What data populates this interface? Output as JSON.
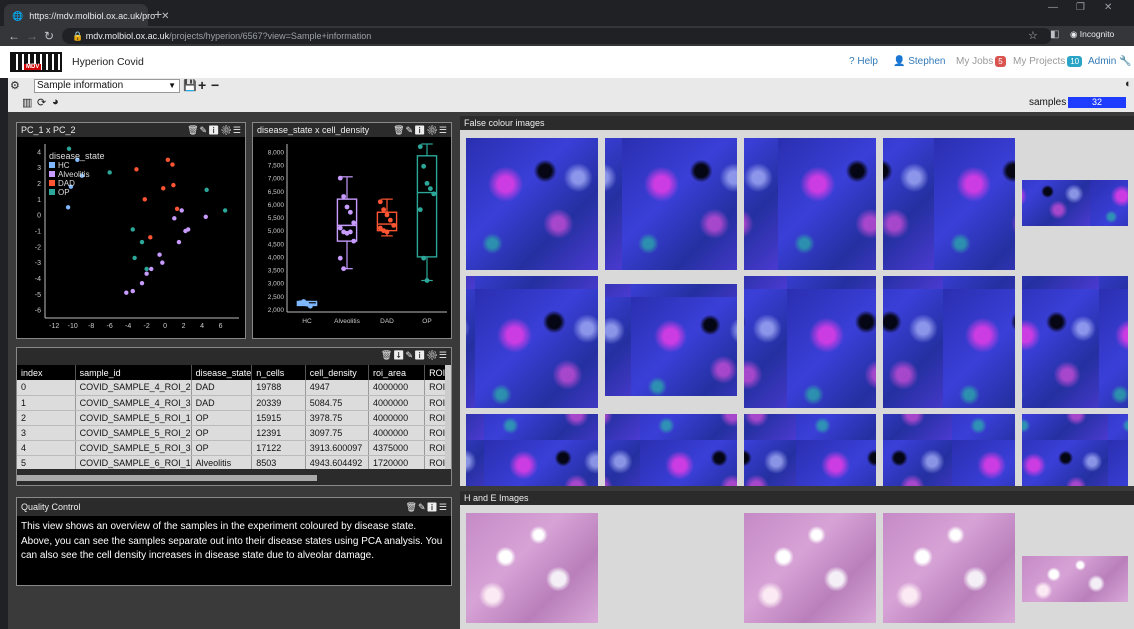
{
  "browser": {
    "tab_title": "https://mdv.molbiol.ox.ac.uk/pro",
    "url_host": "mdv.molbiol.ox.ac.uk",
    "url_path": "/projects/hyperion/6567?view=Sample+information",
    "incognito_label": "Incognito"
  },
  "header": {
    "logo_text": "MDV",
    "title": "Hyperion Covid",
    "help": "Help",
    "user": "Stephen",
    "my_jobs": "My Jobs",
    "my_jobs_count": "5",
    "my_projects": "My Projects",
    "my_projects_count": "10",
    "admin": "Admin"
  },
  "toolbar": {
    "view_select": "Sample information",
    "samples_label": "samples",
    "samples_count": "32"
  },
  "pca": {
    "title": "PC_1 x PC_2",
    "legend_title": "disease_state",
    "legend": [
      {
        "label": "HC",
        "color": "#7fb8ff"
      },
      {
        "label": "Alveolitis",
        "color": "#c79bff"
      },
      {
        "label": "DAD",
        "color": "#ff5533"
      },
      {
        "label": "OP",
        "color": "#2ca89a"
      }
    ]
  },
  "box": {
    "title": "disease_state x cell_density"
  },
  "table": {
    "columns": [
      "index",
      "sample_id",
      "disease_state",
      "n_cells",
      "cell_density",
      "roi_area",
      "ROI"
    ],
    "rows": [
      [
        "0",
        "COVID_SAMPLE_4_ROI_2",
        "DAD",
        "19788",
        "4947",
        "4000000",
        "ROI"
      ],
      [
        "1",
        "COVID_SAMPLE_4_ROI_3",
        "DAD",
        "20339",
        "5084.75",
        "4000000",
        "ROI"
      ],
      [
        "2",
        "COVID_SAMPLE_5_ROI_1",
        "OP",
        "15915",
        "3978.75",
        "4000000",
        "ROI"
      ],
      [
        "3",
        "COVID_SAMPLE_5_ROI_2",
        "OP",
        "12391",
        "3097.75",
        "4000000",
        "ROI"
      ],
      [
        "4",
        "COVID_SAMPLE_5_ROI_3",
        "OP",
        "17122",
        "3913.600097",
        "4375000",
        "ROI"
      ],
      [
        "5",
        "COVID_SAMPLE_6_ROI_1",
        "Alveolitis",
        "8503",
        "4943.604492",
        "1720000",
        "ROI"
      ]
    ]
  },
  "qc": {
    "title": "Quality Control",
    "text": "This view shows an overview of the samples in the experiment coloured by disease state. Above, you can see the samples separate out into their disease states using PCA analysis. You can also see the cell density increases in disease state due to alveolar damage."
  },
  "images": {
    "false_colour_title": "False colour images",
    "he_title": "H and E Images"
  },
  "chart_data": [
    {
      "type": "scatter",
      "title": "PC_1 x PC_2",
      "xlabel": "",
      "ylabel": "",
      "xlim": [
        -13,
        8
      ],
      "ylim": [
        -6.5,
        4.5
      ],
      "x_ticks": [
        -12,
        -10,
        -8,
        -6,
        -4,
        -2,
        0,
        2,
        4,
        6
      ],
      "y_ticks": [
        4,
        3,
        2,
        1,
        0,
        -1,
        -2,
        -3,
        -4,
        -5,
        -6
      ],
      "series": [
        {
          "name": "HC",
          "points": [
            [
              -9.5,
              3.5
            ],
            [
              -10.2,
              1.8
            ],
            [
              -9.0,
              2.5
            ],
            [
              -10.5,
              0.5
            ]
          ]
        },
        {
          "name": "Alveolitis",
          "points": [
            [
              1.5,
              -1.7
            ],
            [
              2.5,
              -0.9
            ],
            [
              2.2,
              -1.0
            ],
            [
              -2.0,
              -3.7
            ],
            [
              -1.5,
              -3.4
            ],
            [
              -2.5,
              -4.3
            ],
            [
              -3.5,
              -4.8
            ],
            [
              -4.2,
              -4.9
            ],
            [
              -0.6,
              -2.5
            ],
            [
              -0.3,
              -3.0
            ],
            [
              1.0,
              -0.2
            ],
            [
              1.8,
              0.3
            ],
            [
              4.4,
              -0.1
            ]
          ]
        },
        {
          "name": "DAD",
          "points": [
            [
              0.3,
              3.5
            ],
            [
              0.8,
              3.2
            ],
            [
              -3.1,
              2.9
            ],
            [
              -0.2,
              1.7
            ],
            [
              0.9,
              1.9
            ],
            [
              -2.2,
              1.0
            ],
            [
              1.3,
              0.4
            ],
            [
              -1.6,
              -1.4
            ]
          ]
        },
        {
          "name": "OP",
          "points": [
            [
              -10.4,
              4.2
            ],
            [
              -6.0,
              2.7
            ],
            [
              -3.5,
              -0.9
            ],
            [
              -2.5,
              -1.7
            ],
            [
              -3.3,
              -2.7
            ],
            [
              -2.0,
              -3.4
            ],
            [
              6.5,
              0.3
            ],
            [
              4.5,
              1.6
            ]
          ]
        }
      ]
    },
    {
      "type": "box",
      "title": "disease_state x cell_density",
      "categories": [
        "HC",
        "Alveolitis",
        "DAD",
        "OP"
      ],
      "y_ticks": [
        2000,
        2500,
        3000,
        3500,
        4000,
        4500,
        5000,
        5500,
        6000,
        6500,
        7000,
        7500,
        8000
      ],
      "ylim": [
        1900,
        8300
      ],
      "boxes": [
        {
          "category": "HC",
          "min": 2150,
          "q1": 2150,
          "median": 2200,
          "q3": 2300,
          "max": 2300,
          "points": [
            2250,
            2300,
            2200,
            2120
          ],
          "color": "#7fb8ff"
        },
        {
          "category": "Alveolitis",
          "min": 3550,
          "q1": 4600,
          "median": 5200,
          "q3": 6200,
          "max": 7050,
          "points": [
            7000,
            6300,
            5900,
            5700,
            5300,
            5100,
            4950,
            4900,
            4950,
            4600,
            3950,
            3550
          ],
          "color": "#c79bff"
        },
        {
          "category": "DAD",
          "min": 4800,
          "q1": 5000,
          "median": 5250,
          "q3": 5700,
          "max": 6200,
          "points": [
            6100,
            5800,
            5600,
            5400,
            5200,
            5100,
            5000,
            4950
          ],
          "color": "#ff5533"
        },
        {
          "category": "OP",
          "min": 3100,
          "q1": 4000,
          "median": 6450,
          "q3": 7850,
          "max": 8300,
          "points": [
            8200,
            7450,
            6800,
            6600,
            6400,
            5800,
            3950,
            3100
          ],
          "color": "#2ca89a"
        }
      ]
    }
  ]
}
